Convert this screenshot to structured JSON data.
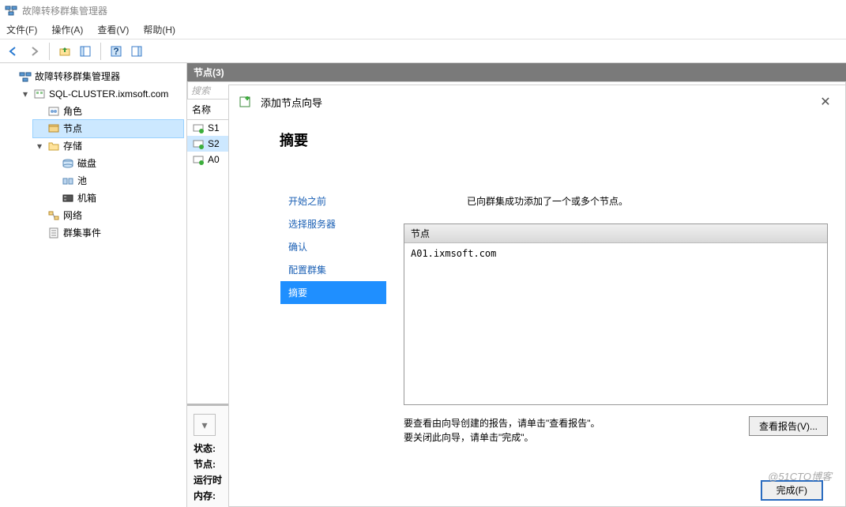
{
  "app": {
    "title": "故障转移群集管理器"
  },
  "menu": {
    "file": "文件(F)",
    "action": "操作(A)",
    "view": "查看(V)",
    "help": "帮助(H)"
  },
  "tree": {
    "root": "故障转移群集管理器",
    "cluster": "SQL-CLUSTER.ixmsoft.com",
    "roles": "角色",
    "nodes": "节点",
    "storage": "存储",
    "disks": "磁盘",
    "pools": "池",
    "enclosure": "机箱",
    "networks": "网络",
    "events": "群集事件"
  },
  "center": {
    "header": "节点(3)",
    "search_placeholder": "搜索",
    "col_name": "名称",
    "rows": [
      "S1",
      "S2",
      "A0"
    ]
  },
  "details": {
    "status_label": "状态:",
    "node_label": "节点:",
    "runtime_label": "运行时",
    "memory_label": "内存:"
  },
  "wizard": {
    "title": "添加节点向导",
    "heading": "摘要",
    "steps": {
      "before": "开始之前",
      "select": "选择服务器",
      "confirm": "确认",
      "configure": "配置群集",
      "summary": "摘要"
    },
    "success_msg": "已向群集成功添加了一个或多个节点。",
    "result_head": "节点",
    "result_body": "A01.ixmsoft.com",
    "hint_line1": "要查看由向导创建的报告，请单击\"查看报告\"。",
    "hint_line2": "要关闭此向导，请单击\"完成\"。",
    "btn_report": "查看报告(V)...",
    "btn_finish": "完成(F)"
  },
  "watermark": "@51CTO博客"
}
